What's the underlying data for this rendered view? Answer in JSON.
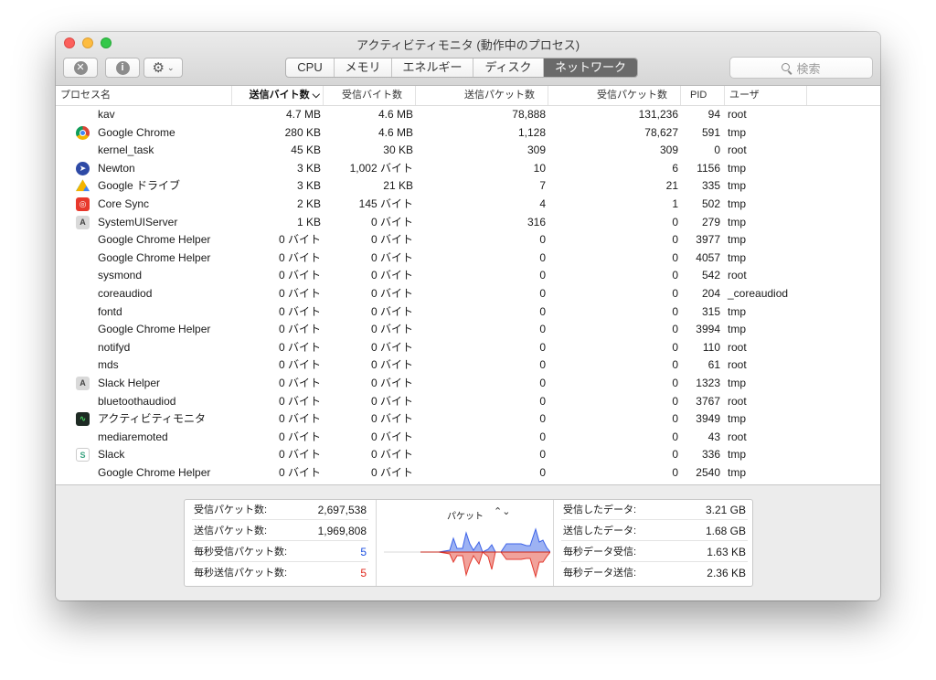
{
  "window": {
    "title": "アクティビティモニタ (動作中のプロセス)"
  },
  "toolbar": {
    "stop_icon": "x-circle-icon",
    "info_icon": "info-circle-icon",
    "gear_icon": "gear-icon",
    "tabs": [
      "CPU",
      "メモリ",
      "エネルギー",
      "ディスク",
      "ネットワーク"
    ],
    "active_tab": "ネットワーク",
    "search_placeholder": "検索"
  },
  "table": {
    "columns": [
      "プロセス名",
      "送信バイト数",
      "受信バイト数",
      "送信パケット数",
      "受信パケット数",
      "PID",
      "ユーザ"
    ],
    "sort_indicator": "⌵",
    "rows": [
      {
        "name": "kav",
        "icon": "",
        "sent_bytes": "4.7 MB",
        "recv_bytes": "4.6 MB",
        "sent_packets": "78,888",
        "recv_packets": "131,236",
        "pid": "94",
        "user": "root"
      },
      {
        "name": "Google Chrome",
        "icon": "chrome-icon",
        "sent_bytes": "280 KB",
        "recv_bytes": "4.6 MB",
        "sent_packets": "1,128",
        "recv_packets": "78,627",
        "pid": "591",
        "user": "tmp"
      },
      {
        "name": "kernel_task",
        "icon": "",
        "sent_bytes": "45 KB",
        "recv_bytes": "30 KB",
        "sent_packets": "309",
        "recv_packets": "309",
        "pid": "0",
        "user": "root"
      },
      {
        "name": "Newton",
        "icon": "newton-icon",
        "sent_bytes": "3 KB",
        "recv_bytes": "1,002 バイト",
        "sent_packets": "10",
        "recv_packets": "6",
        "pid": "1156",
        "user": "tmp"
      },
      {
        "name": "Google ドライブ",
        "icon": "google-drive-icon",
        "sent_bytes": "3 KB",
        "recv_bytes": "21 KB",
        "sent_packets": "7",
        "recv_packets": "21",
        "pid": "335",
        "user": "tmp"
      },
      {
        "name": "Core Sync",
        "icon": "core-sync-icon",
        "sent_bytes": "2 KB",
        "recv_bytes": "145 バイト",
        "sent_packets": "4",
        "recv_packets": "1",
        "pid": "502",
        "user": "tmp"
      },
      {
        "name": "SystemUIServer",
        "icon": "systemuiserver-icon",
        "sent_bytes": "1 KB",
        "recv_bytes": "0 バイト",
        "sent_packets": "316",
        "recv_packets": "0",
        "pid": "279",
        "user": "tmp"
      },
      {
        "name": "Google Chrome Helper",
        "icon": "",
        "sent_bytes": "0 バイト",
        "recv_bytes": "0 バイト",
        "sent_packets": "0",
        "recv_packets": "0",
        "pid": "3977",
        "user": "tmp"
      },
      {
        "name": "Google Chrome Helper",
        "icon": "",
        "sent_bytes": "0 バイト",
        "recv_bytes": "0 バイト",
        "sent_packets": "0",
        "recv_packets": "0",
        "pid": "4057",
        "user": "tmp"
      },
      {
        "name": "sysmond",
        "icon": "",
        "sent_bytes": "0 バイト",
        "recv_bytes": "0 バイト",
        "sent_packets": "0",
        "recv_packets": "0",
        "pid": "542",
        "user": "root"
      },
      {
        "name": "coreaudiod",
        "icon": "",
        "sent_bytes": "0 バイト",
        "recv_bytes": "0 バイト",
        "sent_packets": "0",
        "recv_packets": "0",
        "pid": "204",
        "user": "_coreaudiod"
      },
      {
        "name": "fontd",
        "icon": "",
        "sent_bytes": "0 バイト",
        "recv_bytes": "0 バイト",
        "sent_packets": "0",
        "recv_packets": "0",
        "pid": "315",
        "user": "tmp"
      },
      {
        "name": "Google Chrome Helper",
        "icon": "",
        "sent_bytes": "0 バイト",
        "recv_bytes": "0 バイト",
        "sent_packets": "0",
        "recv_packets": "0",
        "pid": "3994",
        "user": "tmp"
      },
      {
        "name": "notifyd",
        "icon": "",
        "sent_bytes": "0 バイト",
        "recv_bytes": "0 バイト",
        "sent_packets": "0",
        "recv_packets": "0",
        "pid": "110",
        "user": "root"
      },
      {
        "name": "mds",
        "icon": "",
        "sent_bytes": "0 バイト",
        "recv_bytes": "0 バイト",
        "sent_packets": "0",
        "recv_packets": "0",
        "pid": "61",
        "user": "root"
      },
      {
        "name": "Slack Helper",
        "icon": "slack-helper-icon",
        "sent_bytes": "0 バイト",
        "recv_bytes": "0 バイト",
        "sent_packets": "0",
        "recv_packets": "0",
        "pid": "1323",
        "user": "tmp"
      },
      {
        "name": "bluetoothaudiod",
        "icon": "",
        "sent_bytes": "0 バイト",
        "recv_bytes": "0 バイト",
        "sent_packets": "0",
        "recv_packets": "0",
        "pid": "3767",
        "user": "root"
      },
      {
        "name": "アクティビティモニタ",
        "icon": "activity-monitor-icon",
        "sent_bytes": "0 バイト",
        "recv_bytes": "0 バイト",
        "sent_packets": "0",
        "recv_packets": "0",
        "pid": "3949",
        "user": "tmp"
      },
      {
        "name": "mediaremoted",
        "icon": "",
        "sent_bytes": "0 バイト",
        "recv_bytes": "0 バイト",
        "sent_packets": "0",
        "recv_packets": "0",
        "pid": "43",
        "user": "root"
      },
      {
        "name": "Slack",
        "icon": "slack-icon",
        "sent_bytes": "0 バイト",
        "recv_bytes": "0 バイト",
        "sent_packets": "0",
        "recv_packets": "0",
        "pid": "336",
        "user": "tmp"
      },
      {
        "name": "Google Chrome Helper",
        "icon": "",
        "sent_bytes": "0 バイト",
        "recv_bytes": "0 バイト",
        "sent_packets": "0",
        "recv_packets": "0",
        "pid": "2540",
        "user": "tmp"
      }
    ]
  },
  "footer": {
    "left": [
      {
        "label": "受信パケット数:",
        "value": "2,697,538",
        "color": ""
      },
      {
        "label": "送信パケット数:",
        "value": "1,969,808",
        "color": ""
      },
      {
        "label": "毎秒受信パケット数:",
        "value": "5",
        "color": "blue"
      },
      {
        "label": "毎秒送信パケット数:",
        "value": "5",
        "color": "red"
      }
    ],
    "graph": {
      "title": "パケット",
      "toggle": "⌃⌄",
      "colors": {
        "received": "#3d63e8",
        "sent": "#e23b30"
      }
    },
    "right": [
      {
        "label": "受信したデータ:",
        "value": "3.21 GB"
      },
      {
        "label": "送信したデータ:",
        "value": "1.68 GB"
      },
      {
        "label": "毎秒データ受信:",
        "value": "1.63 KB"
      },
      {
        "label": "毎秒データ送信:",
        "value": "2.36 KB"
      }
    ]
  }
}
